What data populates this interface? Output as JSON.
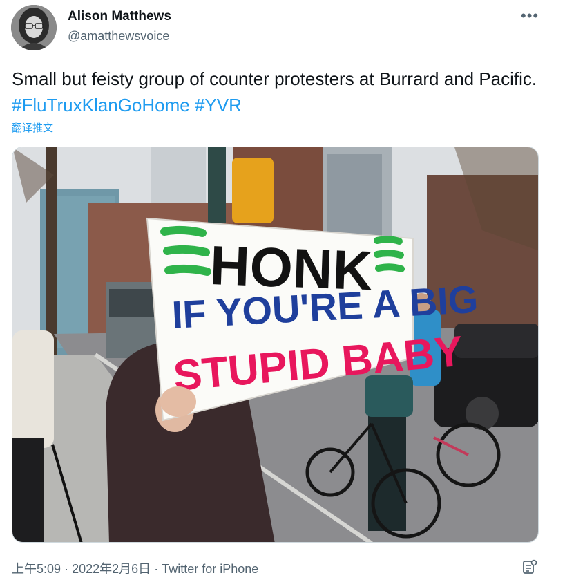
{
  "user": {
    "display_name": "Alison Matthews",
    "handle": "@amatthewsvoice"
  },
  "tweet": {
    "text_plain": "Small but feisty group of counter protesters at Burrard and Pacific.",
    "hashtags": [
      "#FluTruxKlanGoHome",
      "#YVR"
    ],
    "translate_label": "翻译推文"
  },
  "photo": {
    "sign_line1": "HONK",
    "sign_line2": "IF YOU'RE A BIG",
    "sign_line3": "STUPID BABY"
  },
  "meta": {
    "time": "上午5:09",
    "separator1": "·",
    "date": "2022年2月6日",
    "separator2": "·",
    "source": "Twitter for iPhone"
  },
  "icons": {
    "more": "more-options-icon",
    "analytics": "analytics-icon"
  },
  "colors": {
    "hashtag": "#1d9bf0",
    "secondary_text": "#536471",
    "sign_green": "#2fb34a",
    "sign_blue": "#1f3f9c",
    "sign_pink": "#e8175d"
  }
}
